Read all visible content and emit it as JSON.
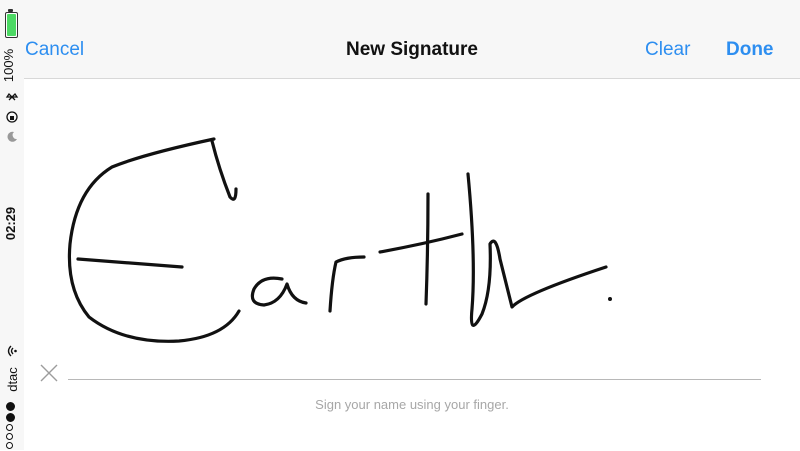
{
  "status_bar": {
    "battery_percent_label": "100%",
    "battery_level": 1.0,
    "time": "02:29",
    "carrier": "dtac",
    "signal_bars_filled": 2,
    "signal_bars_total": 5,
    "icons": [
      "battery-charging-icon",
      "bluetooth-icon",
      "orientation-lock-icon",
      "moon-icon",
      "wifi-icon"
    ]
  },
  "navbar": {
    "cancel_label": "Cancel",
    "title": "New Signature",
    "clear_label": "Clear",
    "done_label": "Done",
    "accent_color": "#2d8ef0"
  },
  "signature": {
    "hint": "Sign your name using your finger.",
    "ink_color": "#111111",
    "clear_icon": "close-icon"
  }
}
